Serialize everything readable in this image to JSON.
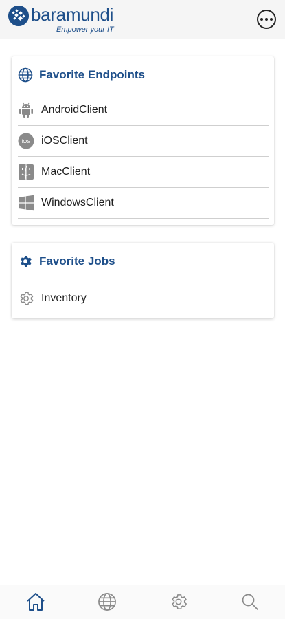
{
  "header": {
    "brand": "baramundi",
    "tagline": "Empower your IT",
    "menu_icon": "more-horizontal-circle-icon"
  },
  "favorite_endpoints": {
    "title": "Favorite Endpoints",
    "icon": "globe-icon",
    "items": [
      {
        "label": "AndroidClient",
        "icon": "android-icon"
      },
      {
        "label": "iOSClient",
        "icon": "ios-icon",
        "icon_text": "iOS"
      },
      {
        "label": "MacClient",
        "icon": "mac-finder-icon"
      },
      {
        "label": "WindowsClient",
        "icon": "windows-icon"
      }
    ]
  },
  "favorite_jobs": {
    "title": "Favorite Jobs",
    "icon": "gear-icon",
    "items": [
      {
        "label": "Inventory",
        "icon": "gear-outline-icon"
      }
    ]
  },
  "bottom_nav": {
    "items": [
      {
        "name": "home",
        "icon": "home-icon",
        "active": true
      },
      {
        "name": "endpoints",
        "icon": "globe-icon",
        "active": false
      },
      {
        "name": "jobs",
        "icon": "gear-icon",
        "active": false
      },
      {
        "name": "search",
        "icon": "search-icon",
        "active": false
      }
    ]
  },
  "colors": {
    "brand": "#1e4f8a",
    "header_bg": "#f5f5f5",
    "icon_gray": "#8a8a8a",
    "divider": "#cfcfcf"
  }
}
